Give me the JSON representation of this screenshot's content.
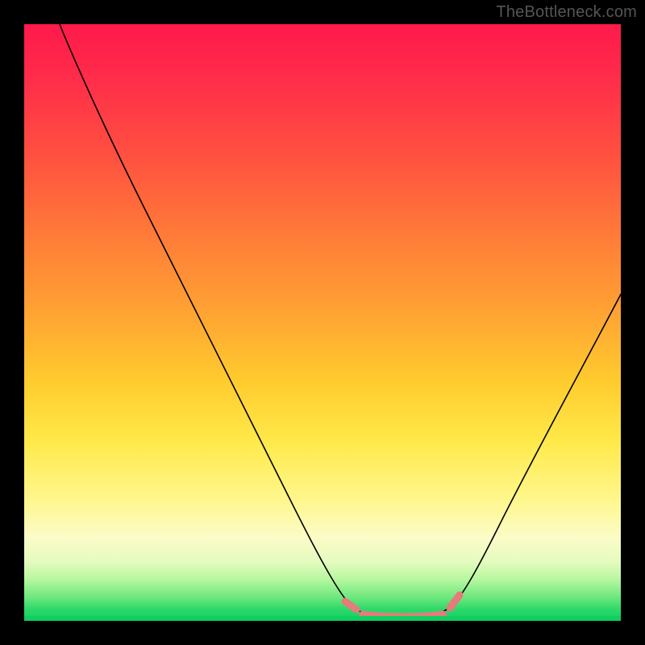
{
  "watermark": "TheBottleneck.com",
  "chart_data": {
    "type": "line",
    "title": "",
    "xlabel": "",
    "ylabel": "",
    "xlim": [
      0,
      100
    ],
    "ylim": [
      0,
      100
    ],
    "grid": false,
    "legend": false,
    "background_gradient": {
      "stops": [
        {
          "pos": 0.0,
          "color": "#ff1a4b"
        },
        {
          "pos": 0.22,
          "color": "#ff5040"
        },
        {
          "pos": 0.48,
          "color": "#ffa233"
        },
        {
          "pos": 0.7,
          "color": "#ffe94a"
        },
        {
          "pos": 0.86,
          "color": "#fbfcc7"
        },
        {
          "pos": 0.93,
          "color": "#b8f7a0"
        },
        {
          "pos": 1.0,
          "color": "#0fcf60"
        }
      ]
    },
    "series": [
      {
        "name": "bottleneck-curve",
        "x": [
          6,
          12,
          18,
          24,
          30,
          36,
          42,
          48,
          54,
          58,
          60,
          65,
          70,
          72,
          76,
          82,
          88,
          94,
          100
        ],
        "y": [
          100,
          89,
          78,
          67,
          56,
          45,
          34,
          23,
          12,
          5,
          2,
          1,
          1,
          2,
          7,
          18,
          30,
          42,
          55
        ]
      }
    ],
    "annotations": [
      {
        "name": "optimal-range-marker",
        "x_range": [
          55,
          72
        ],
        "y": 1,
        "color": "#e57b7b"
      }
    ]
  },
  "colors": {
    "black": "#000000",
    "watermark": "#555555",
    "marker_pink": "#e57b7b"
  }
}
